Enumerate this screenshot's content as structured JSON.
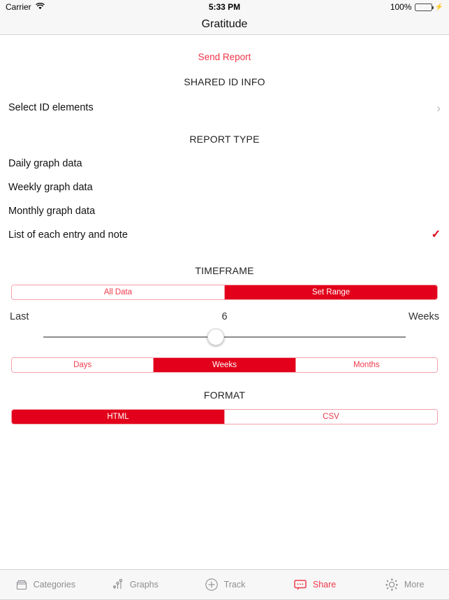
{
  "status_bar": {
    "carrier": "Carrier",
    "wifi_icon": "wifi-icon",
    "time": "5:33 PM",
    "battery_percent": "100%",
    "battery_icon": "battery-icon",
    "charging_icon": "lightning-bolt-icon"
  },
  "nav": {
    "title": "Gratitude"
  },
  "send_report": {
    "label": "Send Report"
  },
  "shared_id_info": {
    "header": "SHARED ID INFO",
    "row_label": "Select ID elements",
    "chevron_icon": "chevron-right-icon"
  },
  "report_type": {
    "header": "REPORT TYPE",
    "options": [
      {
        "label": "Daily graph data",
        "selected": false
      },
      {
        "label": "Weekly graph data",
        "selected": false
      },
      {
        "label": "Monthly graph data",
        "selected": false
      },
      {
        "label": "List of each entry and note",
        "selected": true
      }
    ],
    "check_icon": "checkmark-icon"
  },
  "timeframe": {
    "header": "TIMEFRAME",
    "range_segments": [
      {
        "label": "All Data",
        "selected": false
      },
      {
        "label": "Set Range",
        "selected": true
      }
    ],
    "slider": {
      "prefix_label": "Last",
      "value": "6",
      "unit_label": "Weeks",
      "position_percent": 47.5
    },
    "unit_segments": [
      {
        "label": "Days",
        "selected": false
      },
      {
        "label": "Weeks",
        "selected": true
      },
      {
        "label": "Months",
        "selected": false
      }
    ]
  },
  "format": {
    "header": "FORMAT",
    "segments": [
      {
        "label": "HTML",
        "selected": true
      },
      {
        "label": "CSV",
        "selected": false
      }
    ]
  },
  "tabbar": {
    "tabs": [
      {
        "label": "Categories",
        "icon": "categories-box-icon",
        "active": false
      },
      {
        "label": "Graphs",
        "icon": "graphs-scatter-icon",
        "active": false
      },
      {
        "label": "Track",
        "icon": "plus-circle-icon",
        "active": false
      },
      {
        "label": "Share",
        "icon": "speech-bubble-icon",
        "active": true
      },
      {
        "label": "More",
        "icon": "gear-icon",
        "active": false
      }
    ]
  },
  "colors": {
    "accent_red": "#e2001a",
    "link_red": "#ef3a4c",
    "inactive_gray": "#8e8e93",
    "bar_background": "#f7f7f7"
  }
}
